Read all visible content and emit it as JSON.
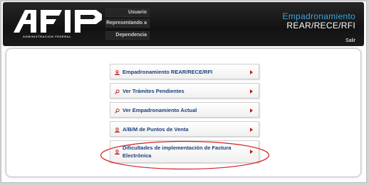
{
  "header": {
    "logo_text": "AFIP",
    "logo_subtitle": "ADMINISTRACION FEDERAL",
    "user_info": {
      "usuario_label": "Usuario",
      "representando_label": "Representando a",
      "dependencia_label": "Dependencia"
    },
    "app_title_line1": "Empadronamiento",
    "app_title_line2": "REAR/RECE/RFI",
    "logout_label": "Salir"
  },
  "menu": {
    "items": [
      {
        "label": "Empadronamiento REAR/RECE/RFI",
        "icon": "user-icon"
      },
      {
        "label": "Ver Trámites Pendientes",
        "icon": "search-icon"
      },
      {
        "label": "Ver Empadronamiento Actual",
        "icon": "search-icon"
      },
      {
        "label": "A/B/M de Puntos de Venta",
        "icon": "user-icon"
      },
      {
        "label": "Dificultades de implementación de Factura Electrónica",
        "icon": "user-icon"
      }
    ]
  },
  "colors": {
    "header_bg": "#1b1b1b",
    "title_blue": "#3fa4dc",
    "menu_text": "#1a3f7a",
    "arrow_red": "#c01818",
    "highlight_red": "#d42020"
  }
}
